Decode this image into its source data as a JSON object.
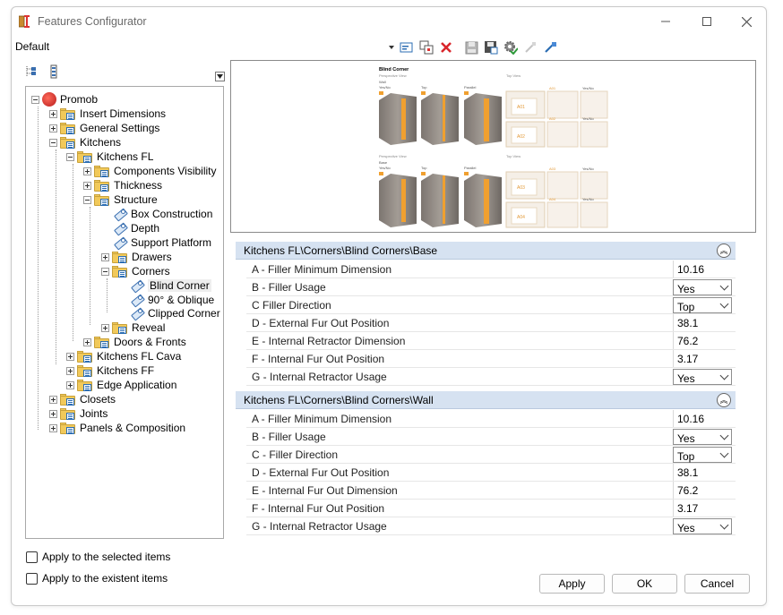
{
  "window": {
    "title": "Features Configurator"
  },
  "profile": {
    "label": "Default"
  },
  "tree": {
    "items": [
      {
        "label": "Promob"
      },
      {
        "label": "Insert Dimensions"
      },
      {
        "label": "General Settings"
      },
      {
        "label": "Kitchens"
      },
      {
        "label": "Kitchens FL"
      },
      {
        "label": "Components Visibility"
      },
      {
        "label": "Thickness"
      },
      {
        "label": "Structure"
      },
      {
        "label": "Box Construction"
      },
      {
        "label": "Depth"
      },
      {
        "label": "Support Platform"
      },
      {
        "label": "Drawers"
      },
      {
        "label": "Corners"
      },
      {
        "label": "Blind Corner"
      },
      {
        "label": "90° & Oblique"
      },
      {
        "label": "Clipped Corner"
      },
      {
        "label": "Reveal"
      },
      {
        "label": "Doors & Fronts"
      },
      {
        "label": "Kitchens FL Cava"
      },
      {
        "label": "Kitchens FF"
      },
      {
        "label": "Edge Application"
      },
      {
        "label": "Closets"
      },
      {
        "label": "Joints"
      },
      {
        "label": "Panels & Composition"
      }
    ]
  },
  "preview": {
    "title": "Blind Corner",
    "perspective_view": "Perspective View",
    "top_view": "Top View",
    "wall": "Wall",
    "base": "Base",
    "yes_no": "Yes/No",
    "top": "Top",
    "parallel": "Parallel",
    "codes": [
      "A01",
      "A02",
      "A03",
      "A04"
    ]
  },
  "groups": [
    {
      "title": "Kitchens FL\\Corners\\Blind Corners\\Base",
      "rows": [
        {
          "label": "A - Filler Minimum Dimension",
          "value": "10.16"
        },
        {
          "label": "B - Filler Usage",
          "value": "Yes"
        },
        {
          "label": "C   Filler Direction",
          "value": "Top"
        },
        {
          "label": "D -  External Fur Out Position",
          "value": "38.1"
        },
        {
          "label": "E - Internal Retractor Dimension",
          "value": "76.2"
        },
        {
          "label": "F - Internal Fur Out Position",
          "value": "3.17"
        },
        {
          "label": "G - Internal Retractor Usage",
          "value": "Yes"
        }
      ]
    },
    {
      "title": "Kitchens FL\\Corners\\Blind Corners\\Wall",
      "rows": [
        {
          "label": "A - Filler Minimum Dimension",
          "value": "10.16"
        },
        {
          "label": "B - Filler Usage",
          "value": "Yes"
        },
        {
          "label": "C - Filler Direction",
          "value": "Top"
        },
        {
          "label": "D -  External Fur Out Position",
          "value": "38.1"
        },
        {
          "label": "E - Internal Fur Out Dimension",
          "value": "76.2"
        },
        {
          "label": "F - Internal Fur Out Position",
          "value": "3.17"
        },
        {
          "label": "G - Internal Retractor Usage",
          "value": "Yes"
        }
      ]
    }
  ],
  "options": {
    "apply_selected": "Apply to the selected items",
    "apply_existent": "Apply to the existent items"
  },
  "buttons": {
    "apply": "Apply",
    "ok": "OK",
    "cancel": "Cancel"
  },
  "colors": {
    "group_header": "#d6e2f1",
    "folder": "#f1c95a",
    "accent_orange": "#f0a030",
    "delete_red": "#d9262b"
  }
}
